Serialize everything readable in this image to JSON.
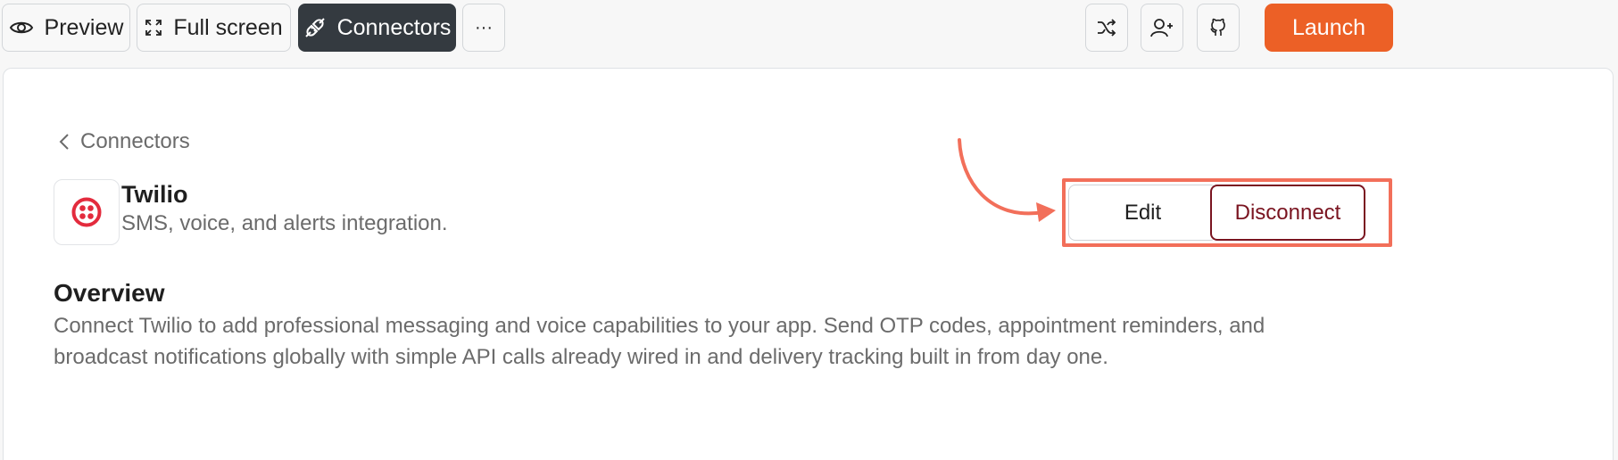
{
  "toolbar": {
    "preview_label": "Preview",
    "fullscreen_label": "Full screen",
    "connectors_label": "Connectors",
    "more_label": "···",
    "launch_label": "Launch",
    "icons": [
      "eye-icon",
      "expand-icon",
      "plug-icon",
      "shuffle-icon",
      "user-plus-icon",
      "github-icon"
    ]
  },
  "breadcrumb": {
    "label": "Connectors"
  },
  "connector": {
    "name": "Twilio",
    "description": "SMS, voice, and alerts integration.",
    "brand_color": "#e32b3d"
  },
  "actions": {
    "edit_label": "Edit",
    "disconnect_label": "Disconnect"
  },
  "overview": {
    "heading": "Overview",
    "body": "Connect Twilio to add professional messaging and voice capabilities to your app. Send OTP codes, appointment reminders, and broadcast notifications globally with simple API calls already wired in and delivery tracking built in from day one."
  },
  "colors": {
    "accent": "#ec6026",
    "annotation": "#f26f5a",
    "danger": "#7a1420",
    "dark_button": "#343a40"
  }
}
